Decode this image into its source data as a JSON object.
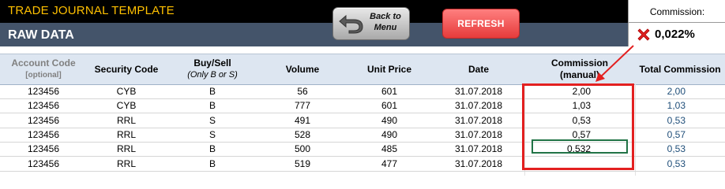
{
  "header": {
    "brand": "TRADE JOURNAL TEMPLATE",
    "section": "RAW DATA",
    "back_button": {
      "line1": "Back to",
      "line2": "Menu",
      "icon": "back-arrow-icon"
    },
    "refresh_button": "REFRESH"
  },
  "commission": {
    "label": "Commission:",
    "icon": "red-x-icon",
    "value": "0,022%"
  },
  "table": {
    "columns": {
      "account_code": "Account Code",
      "account_code_sub": "[optional]",
      "security_code": "Security Code",
      "buy_sell": "Buy/Sell",
      "buy_sell_sub": "(Only B or S)",
      "volume": "Volume",
      "unit_price": "Unit Price",
      "date": "Date",
      "commission_manual": "Commission",
      "commission_manual_sub": "(manual)",
      "total_commission": "Total Commission"
    },
    "rows": [
      {
        "account": "123456",
        "security": "CYB",
        "side": "B",
        "volume": "56",
        "price": "601",
        "date": "31.07.2018",
        "manual": "2,00",
        "total": "2,00"
      },
      {
        "account": "123456",
        "security": "CYB",
        "side": "B",
        "volume": "777",
        "price": "601",
        "date": "31.07.2018",
        "manual": "1,03",
        "total": "1,03"
      },
      {
        "account": "123456",
        "security": "RRL",
        "side": "S",
        "volume": "491",
        "price": "490",
        "date": "31.07.2018",
        "manual": "0,53",
        "total": "0,53"
      },
      {
        "account": "123456",
        "security": "RRL",
        "side": "S",
        "volume": "528",
        "price": "490",
        "date": "31.07.2018",
        "manual": "0,57",
        "total": "0,57"
      },
      {
        "account": "123456",
        "security": "RRL",
        "side": "B",
        "volume": "500",
        "price": "485",
        "date": "31.07.2018",
        "manual": "0,532",
        "total": "0,53"
      },
      {
        "account": "123456",
        "security": "RRL",
        "side": "B",
        "volume": "519",
        "account_note": "",
        "price": "477",
        "date": "31.07.2018",
        "manual": "",
        "total": "0,53"
      }
    ]
  },
  "colors": {
    "header_black": "#000000",
    "header_slate": "#44546a",
    "brand_gold": "#ffc000",
    "refresh_red": "#e63b3b",
    "highlight_red": "#e32020",
    "total_blue": "#1f4e79"
  }
}
